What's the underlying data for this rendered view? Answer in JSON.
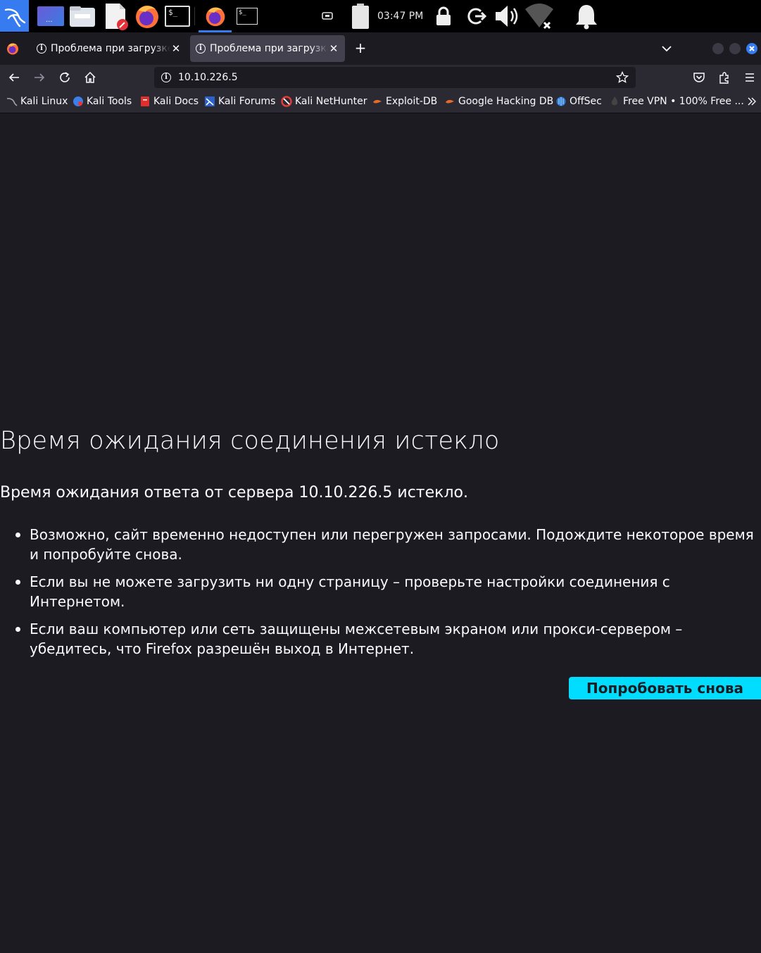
{
  "taskbar": {
    "clock": "03:47 PM",
    "terminal_glyph": "$_"
  },
  "tabs": [
    {
      "label": "Проблема при загрузке страницы",
      "close": "✕"
    },
    {
      "label": "Проблема при загрузке страницы",
      "close": "✕"
    }
  ],
  "tabstrip": {
    "new_tab": "+"
  },
  "navbar": {
    "url": "10.10.226.5"
  },
  "bookmarks": [
    {
      "label": "Kali Linux"
    },
    {
      "label": "Kali Tools"
    },
    {
      "label": "Kali Docs"
    },
    {
      "label": "Kali Forums"
    },
    {
      "label": "Kali NetHunter"
    },
    {
      "label": "Exploit-DB"
    },
    {
      "label": "Google Hacking DB"
    },
    {
      "label": "OffSec"
    },
    {
      "label": "Free VPN • 100% Free ..."
    }
  ],
  "error": {
    "title": "Время ожидания соединения истекло",
    "description": "Время ожидания ответа от сервера 10.10.226.5 истекло.",
    "tips": [
      "Возможно, сайт временно недоступен или перегружен запросами. Подождите некоторое время и попробуйте снова.",
      "Если вы не можете загрузить ни одну страницу – проверьте настройки соединения с Интернетом.",
      "Если ваш компьютер или сеть защищены межсетевым экраном или прокси-сервером – убедитесь, что Firefox разрешён выход в Интернет."
    ],
    "retry_label": "Попробовать снова"
  },
  "colors": {
    "accent": "#00ddff",
    "page_bg": "#1c1b22",
    "toolbar_bg": "#2b2a33",
    "kali_blue": "#367bf0"
  }
}
